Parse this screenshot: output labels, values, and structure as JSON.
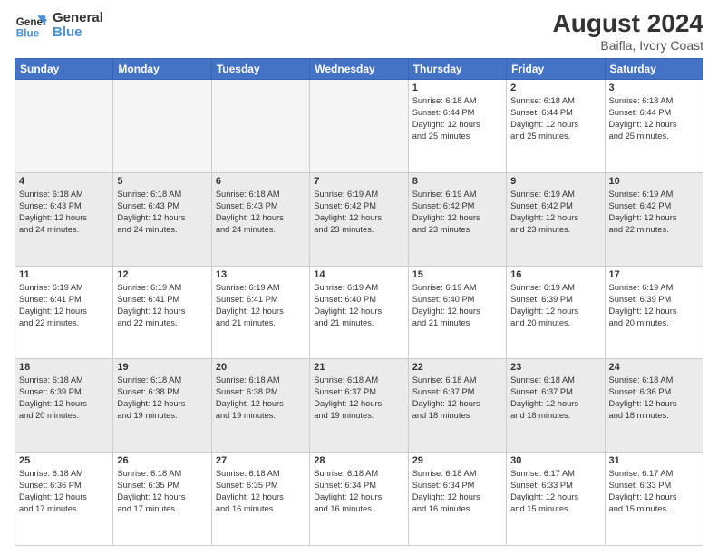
{
  "header": {
    "logo_line1": "General",
    "logo_line2": "Blue",
    "month_year": "August 2024",
    "location": "Baifla, Ivory Coast"
  },
  "days_of_week": [
    "Sunday",
    "Monday",
    "Tuesday",
    "Wednesday",
    "Thursday",
    "Friday",
    "Saturday"
  ],
  "weeks": [
    [
      {
        "day": "",
        "info": ""
      },
      {
        "day": "",
        "info": ""
      },
      {
        "day": "",
        "info": ""
      },
      {
        "day": "",
        "info": ""
      },
      {
        "day": "1",
        "info": "Sunrise: 6:18 AM\nSunset: 6:44 PM\nDaylight: 12 hours\nand 25 minutes."
      },
      {
        "day": "2",
        "info": "Sunrise: 6:18 AM\nSunset: 6:44 PM\nDaylight: 12 hours\nand 25 minutes."
      },
      {
        "day": "3",
        "info": "Sunrise: 6:18 AM\nSunset: 6:44 PM\nDaylight: 12 hours\nand 25 minutes."
      }
    ],
    [
      {
        "day": "4",
        "info": "Sunrise: 6:18 AM\nSunset: 6:43 PM\nDaylight: 12 hours\nand 24 minutes."
      },
      {
        "day": "5",
        "info": "Sunrise: 6:18 AM\nSunset: 6:43 PM\nDaylight: 12 hours\nand 24 minutes."
      },
      {
        "day": "6",
        "info": "Sunrise: 6:18 AM\nSunset: 6:43 PM\nDaylight: 12 hours\nand 24 minutes."
      },
      {
        "day": "7",
        "info": "Sunrise: 6:19 AM\nSunset: 6:42 PM\nDaylight: 12 hours\nand 23 minutes."
      },
      {
        "day": "8",
        "info": "Sunrise: 6:19 AM\nSunset: 6:42 PM\nDaylight: 12 hours\nand 23 minutes."
      },
      {
        "day": "9",
        "info": "Sunrise: 6:19 AM\nSunset: 6:42 PM\nDaylight: 12 hours\nand 23 minutes."
      },
      {
        "day": "10",
        "info": "Sunrise: 6:19 AM\nSunset: 6:42 PM\nDaylight: 12 hours\nand 22 minutes."
      }
    ],
    [
      {
        "day": "11",
        "info": "Sunrise: 6:19 AM\nSunset: 6:41 PM\nDaylight: 12 hours\nand 22 minutes."
      },
      {
        "day": "12",
        "info": "Sunrise: 6:19 AM\nSunset: 6:41 PM\nDaylight: 12 hours\nand 22 minutes."
      },
      {
        "day": "13",
        "info": "Sunrise: 6:19 AM\nSunset: 6:41 PM\nDaylight: 12 hours\nand 21 minutes."
      },
      {
        "day": "14",
        "info": "Sunrise: 6:19 AM\nSunset: 6:40 PM\nDaylight: 12 hours\nand 21 minutes."
      },
      {
        "day": "15",
        "info": "Sunrise: 6:19 AM\nSunset: 6:40 PM\nDaylight: 12 hours\nand 21 minutes."
      },
      {
        "day": "16",
        "info": "Sunrise: 6:19 AM\nSunset: 6:39 PM\nDaylight: 12 hours\nand 20 minutes."
      },
      {
        "day": "17",
        "info": "Sunrise: 6:19 AM\nSunset: 6:39 PM\nDaylight: 12 hours\nand 20 minutes."
      }
    ],
    [
      {
        "day": "18",
        "info": "Sunrise: 6:18 AM\nSunset: 6:39 PM\nDaylight: 12 hours\nand 20 minutes."
      },
      {
        "day": "19",
        "info": "Sunrise: 6:18 AM\nSunset: 6:38 PM\nDaylight: 12 hours\nand 19 minutes."
      },
      {
        "day": "20",
        "info": "Sunrise: 6:18 AM\nSunset: 6:38 PM\nDaylight: 12 hours\nand 19 minutes."
      },
      {
        "day": "21",
        "info": "Sunrise: 6:18 AM\nSunset: 6:37 PM\nDaylight: 12 hours\nand 19 minutes."
      },
      {
        "day": "22",
        "info": "Sunrise: 6:18 AM\nSunset: 6:37 PM\nDaylight: 12 hours\nand 18 minutes."
      },
      {
        "day": "23",
        "info": "Sunrise: 6:18 AM\nSunset: 6:37 PM\nDaylight: 12 hours\nand 18 minutes."
      },
      {
        "day": "24",
        "info": "Sunrise: 6:18 AM\nSunset: 6:36 PM\nDaylight: 12 hours\nand 18 minutes."
      }
    ],
    [
      {
        "day": "25",
        "info": "Sunrise: 6:18 AM\nSunset: 6:36 PM\nDaylight: 12 hours\nand 17 minutes."
      },
      {
        "day": "26",
        "info": "Sunrise: 6:18 AM\nSunset: 6:35 PM\nDaylight: 12 hours\nand 17 minutes."
      },
      {
        "day": "27",
        "info": "Sunrise: 6:18 AM\nSunset: 6:35 PM\nDaylight: 12 hours\nand 16 minutes."
      },
      {
        "day": "28",
        "info": "Sunrise: 6:18 AM\nSunset: 6:34 PM\nDaylight: 12 hours\nand 16 minutes."
      },
      {
        "day": "29",
        "info": "Sunrise: 6:18 AM\nSunset: 6:34 PM\nDaylight: 12 hours\nand 16 minutes."
      },
      {
        "day": "30",
        "info": "Sunrise: 6:17 AM\nSunset: 6:33 PM\nDaylight: 12 hours\nand 15 minutes."
      },
      {
        "day": "31",
        "info": "Sunrise: 6:17 AM\nSunset: 6:33 PM\nDaylight: 12 hours\nand 15 minutes."
      }
    ]
  ]
}
